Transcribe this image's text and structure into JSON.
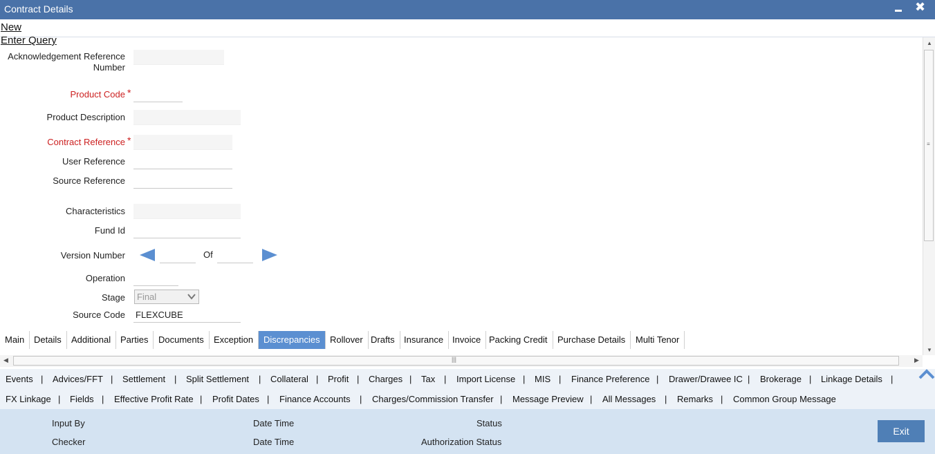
{
  "window": {
    "title": "Contract Details"
  },
  "menu": {
    "new": "New",
    "enter_query": "Enter Query"
  },
  "form": {
    "ack_ref_line1": "Acknowledgement Reference",
    "ack_ref_line2": "Number",
    "product_code": "Product Code",
    "product_description": "Product Description",
    "contract_reference": "Contract Reference",
    "user_reference": "User Reference",
    "source_reference": "Source Reference",
    "characteristics": "Characteristics",
    "fund_id": "Fund Id",
    "version_number": "Version Number",
    "version_of": "Of",
    "operation": "Operation",
    "stage": "Stage",
    "stage_value": "Final",
    "source_code": "Source Code",
    "source_code_value": "FLEXCUBE",
    "required_mark": "*"
  },
  "tabs": [
    "Main",
    "Details",
    "Additional",
    "Parties",
    "Documents",
    "Exception",
    "Discrepancies",
    "Rollover",
    "Drafts",
    "Insurance",
    "Invoice",
    "Packing Credit",
    "Purchase Details",
    "Multi Tenor"
  ],
  "active_tab": "Discrepancies",
  "links_row1": [
    "Events",
    "Advices/FFT",
    "Settlement",
    "Split Settlement",
    "Collateral",
    "Profit",
    "Charges",
    "Tax",
    "Import License",
    "MIS",
    "Finance Preference",
    "Drawer/Drawee IC",
    "Brokerage",
    "Linkage Details"
  ],
  "links_row2": [
    "FX Linkage",
    "Fields",
    "Effective Profit Rate",
    "Profit Dates",
    "Finance Accounts",
    "Charges/Commission Transfer",
    "Message Preview",
    "All Messages",
    "Remarks",
    "Common Group Message"
  ],
  "link_separator": "|",
  "footer": {
    "input_by": "Input By",
    "date_time_1": "Date Time",
    "status": "Status",
    "checker": "Checker",
    "date_time_2": "Date Time",
    "authorization_status": "Authorization Status",
    "exit": "Exit"
  },
  "colors": {
    "titlebar": "#4a72a8",
    "required": "#cc1f1f",
    "active_tab": "#5b8fd1",
    "footer": "#d4e3f2",
    "exit_button": "#4f7fb6",
    "nav_arrow": "#5b8fd1"
  }
}
